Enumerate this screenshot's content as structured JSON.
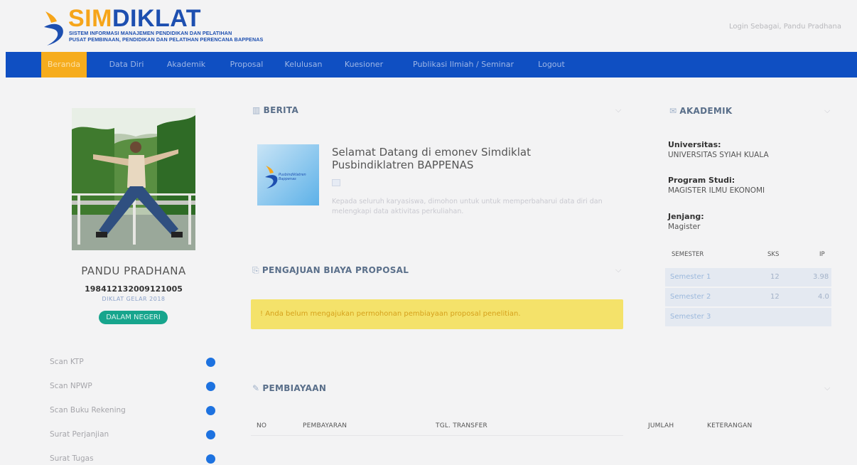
{
  "header": {
    "brand_part1": "SIM",
    "brand_part2": "DIKLAT",
    "subtitle_line1": "SISTEM INFORMASI MANAJEMEN PENDIDIKAN DAN PELATIHAN",
    "subtitle_line2": "PUSAT PEMBINAAN, PENDIDIKAN DAN PELATIHAN PERENCANA BAPPENAS",
    "login_as": "Login Sebagai, Pandu Pradhana"
  },
  "nav": {
    "items": [
      {
        "label": "Beranda",
        "active": true
      },
      {
        "label": "Data Diri",
        "active": false
      },
      {
        "label": "Akademik",
        "active": false
      },
      {
        "label": "Proposal",
        "active": false
      },
      {
        "label": "Kelulusan",
        "active": false
      },
      {
        "label": "Kuesioner",
        "active": false
      },
      {
        "label": "Publikasi Ilmiah / Seminar",
        "active": false
      },
      {
        "label": "Logout",
        "active": false
      }
    ]
  },
  "profile": {
    "name": "PANDU PRADHANA",
    "nip": "198412132009121005",
    "diklat": "DIKLAT GELAR 2018",
    "status_badge": "DALAM NEGERI"
  },
  "documents": [
    {
      "label": "Scan KTP"
    },
    {
      "label": "Scan NPWP"
    },
    {
      "label": "Scan Buku Rekening"
    },
    {
      "label": "Surat Perjanjian"
    },
    {
      "label": "Surat Tugas"
    }
  ],
  "berita": {
    "title": "BERITA",
    "news_title": "Selamat Datang di emonev Simdiklat Pusbindiklatren BAPPENAS",
    "news_body": "Kepada seluruh karyasiswa, dimohon untuk untuk memperbaharui data diri dan melengkapi data aktivitas perkuliahan.",
    "image_caption": "Pusbindiklatren Bappenas"
  },
  "proposal": {
    "title": "PENGAJUAN BIAYA PROPOSAL",
    "alert": "! Anda belum mengajukan permohonan pembiayaan proposal penelitian."
  },
  "pembiayaan": {
    "title": "PEMBIAYAAN",
    "columns": [
      "NO",
      "PEMBAYARAN",
      "TGL. TRANSFER",
      "JUMLAH",
      "KETERANGAN"
    ]
  },
  "akademik": {
    "title": "AKADEMIK",
    "universitas_label": "Universitas:",
    "universitas": "UNIVERSITAS SYIAH KUALA",
    "prodi_label": "Program Studi:",
    "prodi": "MAGISTER ILMU EKONOMI",
    "jenjang_label": "Jenjang:",
    "jenjang": "Magister",
    "columns": [
      "SEMESTER",
      "SKS",
      "IP"
    ],
    "semesters": [
      {
        "name": "Semester 1",
        "sks": "12",
        "ip": "3.98"
      },
      {
        "name": "Semester 2",
        "sks": "12",
        "ip": "4.0"
      },
      {
        "name": "Semester 3",
        "sks": "",
        "ip": ""
      }
    ]
  },
  "colors": {
    "nav_bg": "#0f4fc2",
    "nav_active": "#f6ac1d",
    "brand_orange": "#f6a51a",
    "brand_blue": "#1d4fb0",
    "badge": "#17a58d",
    "alert_bg": "#f4e26a",
    "status_dot": "#1d72e0"
  },
  "icons": {
    "berita": "newspaper-icon",
    "proposal": "file-edit-icon",
    "pembiayaan": "paperclip-icon",
    "akademik": "graduation-cap-icon",
    "collapse": "chevron-down-icon"
  }
}
